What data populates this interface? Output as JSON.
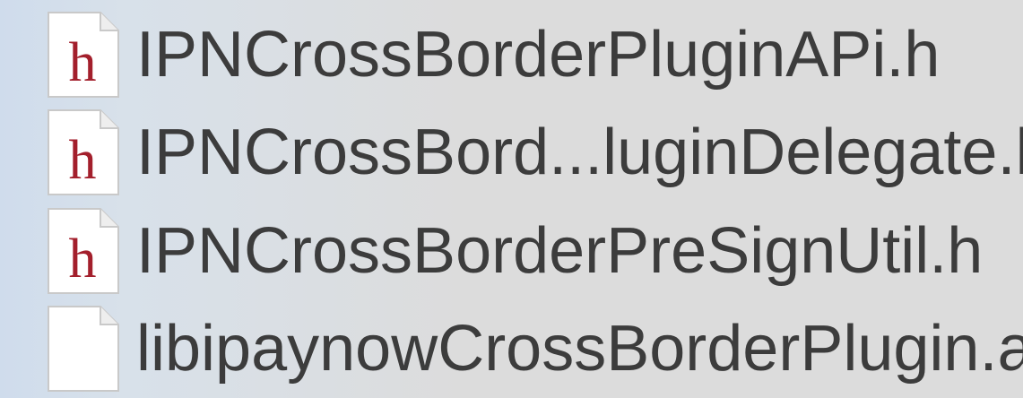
{
  "file_list": {
    "items": [
      {
        "name": "IPNCrossBorderPluginAPi.h",
        "icon": "header-file-icon",
        "icon_glyph": "h"
      },
      {
        "name": "IPNCrossBord...luginDelegate.h",
        "icon": "header-file-icon",
        "icon_glyph": "h"
      },
      {
        "name": "IPNCrossBorderPreSignUtil.h",
        "icon": "header-file-icon",
        "icon_glyph": "h"
      },
      {
        "name": "libipaynowCrossBorderPlugin.a",
        "icon": "blank-file-icon",
        "icon_glyph": ""
      }
    ]
  },
  "colors": {
    "header_glyph": "#a31f2c",
    "text": "#3c3c3c",
    "sidebar_tint": "#cfdcec"
  }
}
